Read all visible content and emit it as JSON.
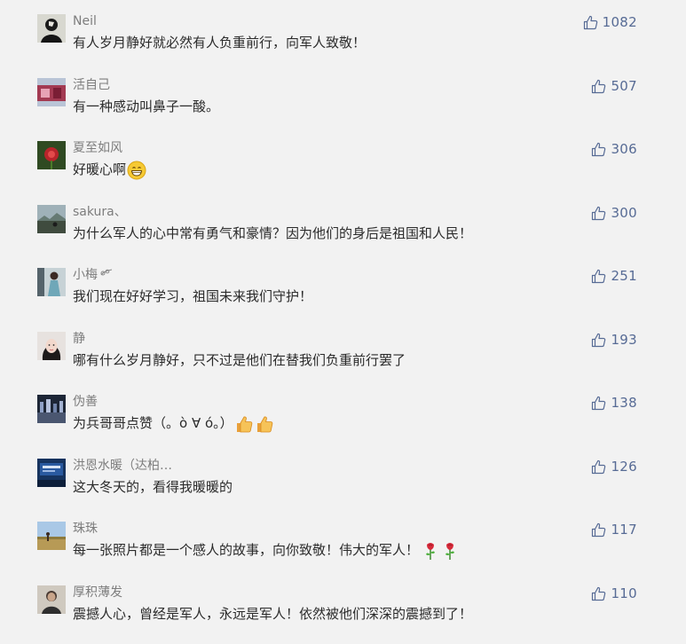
{
  "colors": {
    "background": "#f2f2f2",
    "nickname": "#7d7d7d",
    "content": "#2b2b2b",
    "like": "#576b95"
  },
  "comments": [
    {
      "nickname": "Neil",
      "content": "有人岁月静好就必然有人负重前行，向军人致敬！",
      "likes": "1082",
      "avatar": "dark-figure"
    },
    {
      "nickname": "活自己",
      "content": "有一种感动叫鼻子一酸。",
      "likes": "507",
      "avatar": "red-scene"
    },
    {
      "nickname": "夏至如风",
      "content": "好暖心啊",
      "likes": "306",
      "avatar": "flower",
      "emoji": "grin-emoji"
    },
    {
      "nickname": "sakura、",
      "content": "为什么军人的心中常有勇气和豪情？因为他们的身后是祖国和人民！",
      "likes": "300",
      "avatar": "landscape"
    },
    {
      "nickname": "小梅",
      "content": "我们现在好好学习，祖国未来我们守护！",
      "likes": "251",
      "avatar": "girl-portrait",
      "nickname_icon": "flower-icon"
    },
    {
      "nickname": "静",
      "content": "哪有什么岁月静好，只不过是他们在替我们负重前行罢了",
      "likes": "193",
      "avatar": "woman-face"
    },
    {
      "nickname": "伪善",
      "content": "为兵哥哥点赞（。ò ∀ ó。）",
      "likes": "138",
      "avatar": "city-night",
      "emoji": "thumbs-up-emoji-pair"
    },
    {
      "nickname": "洪恩水暖（达柏…",
      "content": "这大冬天的，看得我暖暖的",
      "likes": "126",
      "avatar": "blue-sign"
    },
    {
      "nickname": "珠珠",
      "content": "每一张照片都是一个感人的故事，向你致敬！伟大的军人！",
      "likes": "117",
      "avatar": "field-sky",
      "emoji": "rose-emoji-pair"
    },
    {
      "nickname": "厚积薄发",
      "content": "震撼人心，曾经是军人，永远是军人！依然被他们深深的震撼到了！",
      "likes": "110",
      "avatar": "man-portrait"
    }
  ]
}
